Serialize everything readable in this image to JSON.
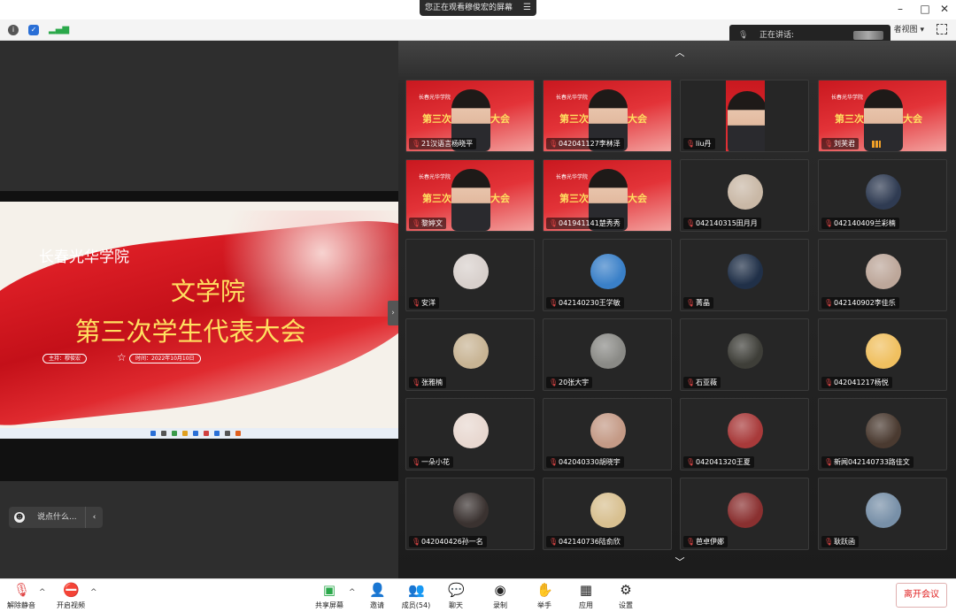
{
  "share_banner": {
    "text": "您正在观看穆俊宏的屏幕",
    "menu_icon": "list-icon"
  },
  "window_controls": {
    "minimize": "–",
    "maximize": "□",
    "close": "✕"
  },
  "infobar": {
    "view_label": "者视图",
    "view_caret": "▾"
  },
  "speaking": {
    "label": "正在讲话:"
  },
  "slide": {
    "college": "长春光华学院",
    "title_line1": "文学院",
    "title_line2": "第三次学生代表大会",
    "host": "主持：穆俊宏",
    "time": "时间：2022年10月10日"
  },
  "chat": {
    "placeholder": "说点什么...",
    "chevron": "‹"
  },
  "gallery": {
    "nav_up": "︿",
    "nav_down": "﹀",
    "tiles": [
      {
        "name": "21汉语言杨晓平",
        "kind": "video"
      },
      {
        "name": "042041127李林泽",
        "kind": "video"
      },
      {
        "name": "liu丹",
        "kind": "video-small"
      },
      {
        "name": "刘芙君",
        "kind": "video"
      },
      {
        "name": "黎婷文",
        "kind": "video"
      },
      {
        "name": "041941141楚秀秀",
        "kind": "video"
      },
      {
        "name": "042140315田月月",
        "kind": "avatar",
        "color": "#c9b8a6"
      },
      {
        "name": "042140409兰彩楠",
        "kind": "avatar",
        "color": "#2f3b52"
      },
      {
        "name": "安洋",
        "kind": "avatar",
        "color": "#d8d0cc"
      },
      {
        "name": "042140230王学敏",
        "kind": "avatar",
        "color": "#3a80c8"
      },
      {
        "name": "菁晶",
        "kind": "avatar",
        "color": "#203048"
      },
      {
        "name": "042140902李佳乐",
        "kind": "avatar",
        "color": "#bda79a"
      },
      {
        "name": "张雅楠",
        "kind": "avatar",
        "color": "#c8b494"
      },
      {
        "name": "20张大宇",
        "kind": "avatar",
        "color": "#8a8a86"
      },
      {
        "name": "石亚薇",
        "kind": "avatar",
        "color": "#3e3e38"
      },
      {
        "name": "042041217杨悦",
        "kind": "avatar",
        "color": "#f0c060"
      },
      {
        "name": "一朵小花",
        "kind": "avatar",
        "color": "#e8d8d0"
      },
      {
        "name": "042040330胡晓宇",
        "kind": "avatar",
        "color": "#c49a86"
      },
      {
        "name": "042041320王夏",
        "kind": "avatar",
        "color": "#a83a3a"
      },
      {
        "name": "新闻042140733路佳文",
        "kind": "avatar",
        "color": "#4a3a30"
      },
      {
        "name": "042040426孙一名",
        "kind": "avatar",
        "color": "#3a3230"
      },
      {
        "name": "042140736陆俞欣",
        "kind": "avatar",
        "color": "#d8c090"
      },
      {
        "name": "芭卓伊娜",
        "kind": "avatar",
        "color": "#8a3030"
      },
      {
        "name": "耿跃函",
        "kind": "avatar",
        "color": "#7890a8"
      }
    ]
  },
  "toolbar": {
    "unmute": "解除静音",
    "start_video": "开启视频",
    "share": "共享屏幕",
    "invite": "邀请",
    "members": "成员(54)",
    "chat": "聊天",
    "record": "录制",
    "raise_hand": "举手",
    "apps": "应用",
    "settings": "设置",
    "leave": "离开会议",
    "caret": "^"
  },
  "colors": {
    "slide_red": "#d8262d",
    "title_yellow": "#ffe060",
    "leave_red": "#e02020",
    "mic_muted": "#e04646"
  }
}
